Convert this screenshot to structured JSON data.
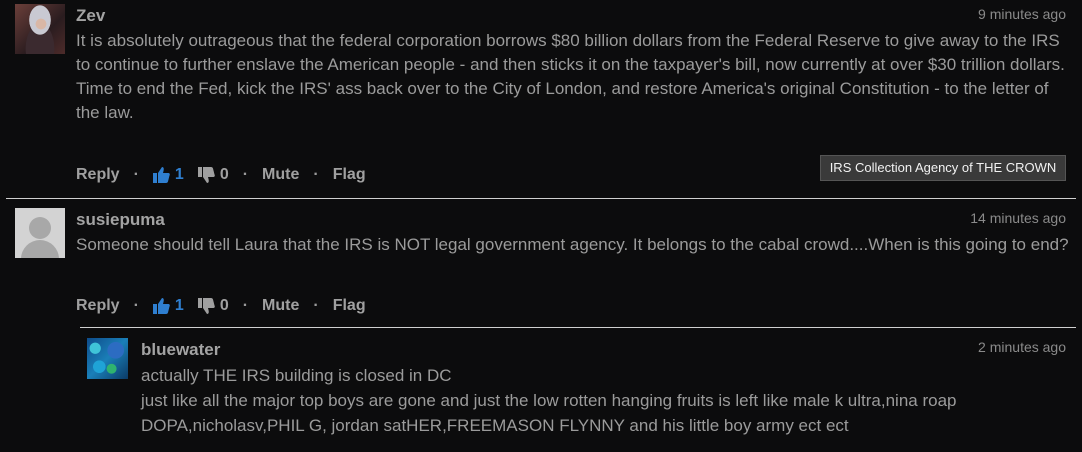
{
  "comments": [
    {
      "author": "Zev",
      "time": "9 minutes ago",
      "avatar": "photo-avatar",
      "paragraphs": [
        "It is absolutely outrageous that the federal corporation borrows $80 billion dollars from the Federal Reserve to give away to the IRS to continue to further enslave the American people - and then sticks it on the taxpayer's bill, now currently at over $30 trillion dollars.",
        "Time to end the Fed, kick the IRS' ass back over to the City of London, and restore America's original Constitution - to the letter of the law."
      ],
      "actions": {
        "reply": "Reply",
        "upvotes": "1",
        "downvotes": "0",
        "mute": "Mute",
        "flag": "Flag"
      }
    },
    {
      "author": "susiepuma",
      "time": "14 minutes ago",
      "avatar": "default-avatar",
      "paragraphs": [
        "Someone should tell Laura that the IRS is NOT legal government agency. It belongs to the cabal crowd....When is this going to end?"
      ],
      "actions": {
        "reply": "Reply",
        "upvotes": "1",
        "downvotes": "0",
        "mute": "Mute",
        "flag": "Flag"
      }
    },
    {
      "author": "bluewater",
      "time": "2 minutes ago",
      "avatar": "reef-photo-avatar",
      "lines": [
        "actually THE IRS building is closed in DC",
        "just like all the major top boys are gone and just the low rotten hanging fruits is left like male k ultra,nina roap",
        "DOPA,nicholasv,PHIL G, jordan satHER,FREEMASON FLYNNY and his little boy army ect ect"
      ]
    }
  ],
  "tooltip": "IRS Collection Agency of THE CROWN",
  "icons": {
    "upvote": "thumbs-up-icon",
    "downvote": "thumbs-down-icon"
  },
  "colors": {
    "background": "#0c0c0d",
    "text": "#9b9b9b",
    "upvote_accent": "#2f7fd0",
    "divider": "#d0d0d0"
  }
}
